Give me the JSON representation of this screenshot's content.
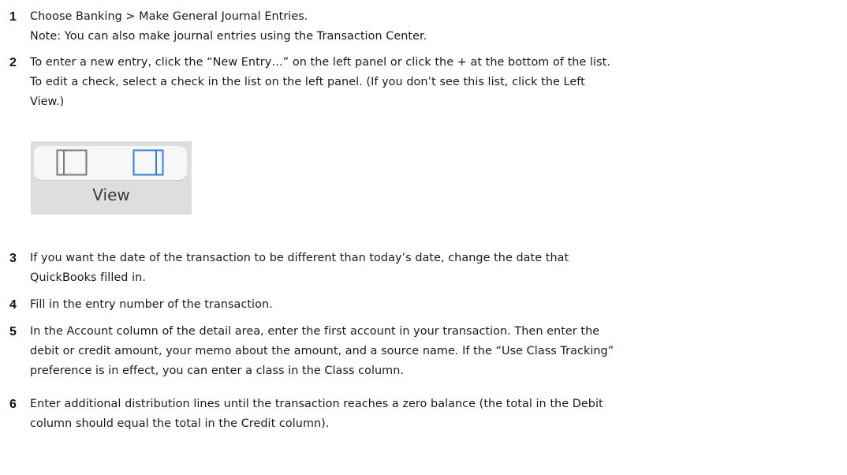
{
  "steps": [
    {
      "number": "1",
      "lines": [
        "Choose Banking > Make General Journal Entries.",
        "Note: You can also make journal entries using the Transaction Center."
      ]
    },
    {
      "number": "2",
      "lines": [
        "To enter a new entry, click the “New Entry…” on the left panel or click the + at the bottom of the list.",
        "To edit a check, select a check in the list on the left panel. (If you don’t see this list, click the Left",
        "View.)"
      ]
    },
    {
      "number": "3",
      "lines": [
        "If you want the date of the transaction to be different than today’s date, change the date that",
        "QuickBooks filled in."
      ]
    },
    {
      "number": "4",
      "lines": [
        "Fill in the entry number of the transaction."
      ]
    },
    {
      "number": "5",
      "lines": [
        "In the Account column of the detail area, enter the first account in your transaction. Then enter the",
        "debit or credit amount, your memo about the amount, and a source name. If the “Use Class Tracking”",
        "preference is in effect, you can enter a class in the Class column."
      ]
    },
    {
      "number": "6",
      "lines": [
        "Enter additional distribution lines until the transaction reaches a zero balance (the total in the Debit",
        "column should equal the total in the Credit column)."
      ]
    }
  ],
  "view_figure": {
    "label": "View",
    "buttons": [
      {
        "icon": "left-view-icon",
        "color": "#7a7a7a"
      },
      {
        "icon": "right-view-icon",
        "color": "#2f7fe0"
      }
    ]
  }
}
